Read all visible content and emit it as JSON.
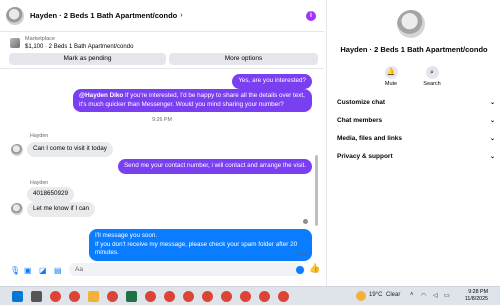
{
  "chat": {
    "header_title": "Hayden · 2 Beds 1 Bath Apartment/condo",
    "listing_source": "Marketplace",
    "listing_desc": "$1,100 · 2 Beds 1 Bath Apartment/condo",
    "mark_pending": "Mark as pending",
    "more_options": "More options",
    "messages": [
      {
        "text": "Yes, are you interested?"
      },
      {
        "mention": "@Hayden Diko",
        "text": " If you're interested, I'd be happy to share all the details over text, it's much quicker than Messenger. Would you mind sharing your number?"
      },
      {
        "text": "Can I come to visit it today"
      },
      {
        "text": "Send me your contact number, i will contact and arrange the visit."
      },
      {
        "text": "4018650929"
      },
      {
        "text": "Let me know if I can"
      },
      {
        "text": "I'll message you soon.\nIf you don't receive my message, please check your spam folder after 20 minutes."
      }
    ],
    "time_separator": "9:26 PM",
    "sender_name": "Hayden",
    "sent_status": "Sent",
    "input_placeholder": "Aa"
  },
  "info": {
    "title": "Hayden · 2 Beds 1 Bath Apartment/condo",
    "mute_label": "Mute",
    "search_label": "Search",
    "sections": [
      "Customize chat",
      "Chat members",
      "Media, files and links",
      "Privacy & support"
    ]
  },
  "taskbar": {
    "temperature": "19°C",
    "weather": "Clear",
    "time": "9:28 PM",
    "date": "11/8/2025",
    "icons": [
      {
        "name": "windows-start-icon",
        "color": "#0078d4"
      },
      {
        "name": "search-icon",
        "color": "#555555"
      },
      {
        "name": "chrome-icon",
        "color": "#db4437"
      },
      {
        "name": "chrome-icon",
        "color": "#db4437"
      },
      {
        "name": "file-explorer-icon",
        "color": "#f2b23a"
      },
      {
        "name": "chrome-icon",
        "color": "#db4437"
      },
      {
        "name": "excel-icon",
        "color": "#1e7145"
      },
      {
        "name": "chrome-icon",
        "color": "#db4437"
      },
      {
        "name": "chrome-icon",
        "color": "#db4437"
      },
      {
        "name": "chrome-icon",
        "color": "#db4437"
      },
      {
        "name": "chrome-icon",
        "color": "#db4437"
      },
      {
        "name": "chrome-icon",
        "color": "#db4437"
      },
      {
        "name": "chrome-icon",
        "color": "#db4437"
      },
      {
        "name": "chrome-icon",
        "color": "#db4437"
      },
      {
        "name": "chrome-icon",
        "color": "#db4437"
      }
    ]
  },
  "colors": {
    "accent_purple": "#7b3ff2",
    "accent_blue": "#0a7cff"
  }
}
